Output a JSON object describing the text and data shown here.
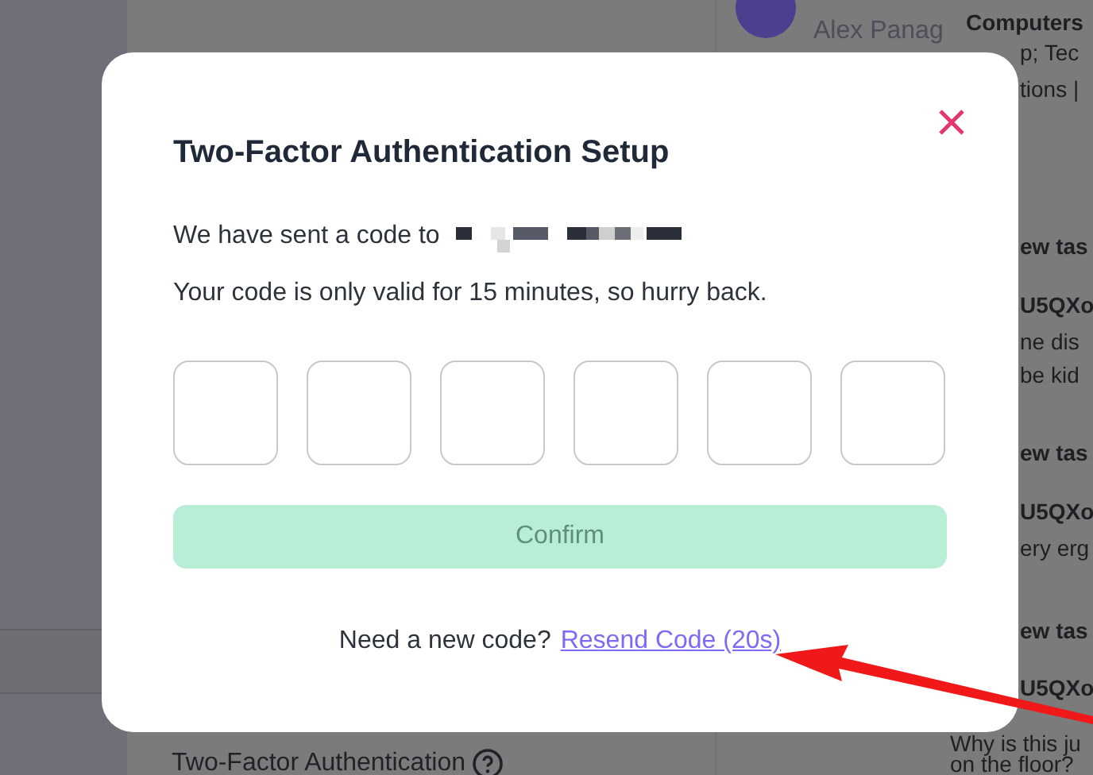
{
  "background": {
    "feed": [
      {
        "kind": "author",
        "text": "Alex Panag"
      },
      {
        "kind": "title",
        "text": "Computers"
      },
      {
        "kind": "line",
        "text": "p; Tec"
      },
      {
        "kind": "line",
        "text": "tions |"
      },
      {
        "kind": "title",
        "text": "ew tas"
      },
      {
        "kind": "title",
        "text": "U5QXo"
      },
      {
        "kind": "line",
        "text": "ne dis"
      },
      {
        "kind": "line",
        "text": "be kid"
      },
      {
        "kind": "title",
        "text": "ew tas"
      },
      {
        "kind": "title",
        "text": "U5QXo"
      },
      {
        "kind": "line",
        "text": "ery erg"
      },
      {
        "kind": "title",
        "text": "ew tas"
      },
      {
        "kind": "title",
        "text": "U5QXo"
      },
      {
        "kind": "line",
        "text": "Why is this ju"
      },
      {
        "kind": "line",
        "text": "on the floor?"
      }
    ],
    "section_heading": "Two-Factor Authentication"
  },
  "dialog": {
    "title": "Two-Factor Authentication Setup",
    "sent_to": "We have sent a code to",
    "validity": "Your code is only valid for 15 minutes, so hurry back.",
    "confirm": {
      "label": "Confirm",
      "disabled": true
    },
    "resend_prompt": "Need a new code?",
    "resend_link": "Resend Code (20s)"
  }
}
